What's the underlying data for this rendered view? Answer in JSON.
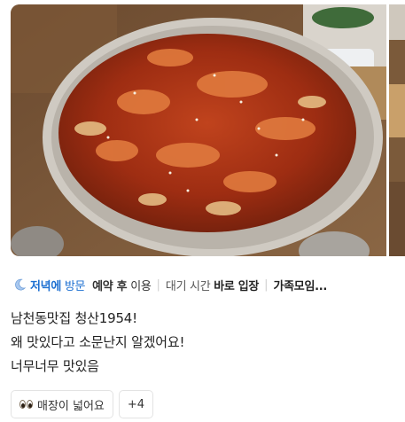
{
  "photo": {
    "main_alt": "스테이크 볶음 요리 사진",
    "next_alt": "다음 사진"
  },
  "visit": {
    "time_label_bold": "저녁에",
    "time_label_rest": " 방문",
    "reserve_bold": "예약 후",
    "reserve_rest": " 이용",
    "wait_prefix": "대기 시간 ",
    "wait_value": "바로 입장",
    "group": "가족모임..."
  },
  "review": {
    "lines": [
      "남천동맛집 청산1954!",
      "왜 맛있다고 소문난지 알겠어요!",
      "너무너무 맛있음"
    ]
  },
  "tags": {
    "first": "매장이 넓어요",
    "more": "+4"
  },
  "colors": {
    "accent": "#1c6fd1"
  }
}
